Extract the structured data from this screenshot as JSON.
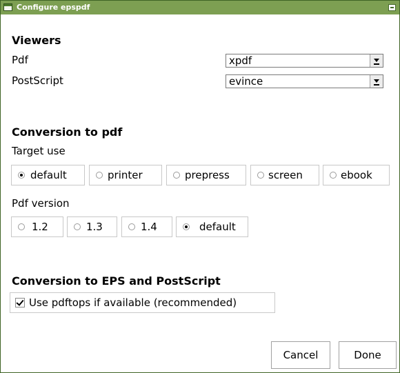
{
  "window": {
    "title": "Configure epspdf"
  },
  "viewers": {
    "heading": "Viewers",
    "pdf": {
      "label": "Pdf",
      "value": "xpdf"
    },
    "postscript": {
      "label": "PostScript",
      "value": "evince"
    }
  },
  "conversion_pdf": {
    "heading": "Conversion to pdf",
    "target_use": {
      "label": "Target use",
      "options": [
        "default",
        "printer",
        "prepress",
        "screen",
        "ebook"
      ],
      "selected": "default"
    },
    "pdf_version": {
      "label": "Pdf version",
      "options": [
        "1.2",
        "1.3",
        "1.4",
        "default"
      ],
      "selected": "default"
    }
  },
  "conversion_eps": {
    "heading": "Conversion to EPS and PostScript",
    "pdftops": {
      "label": "Use pdftops if available (recommended)",
      "checked": true
    }
  },
  "buttons": {
    "cancel": "Cancel",
    "done": "Done"
  }
}
